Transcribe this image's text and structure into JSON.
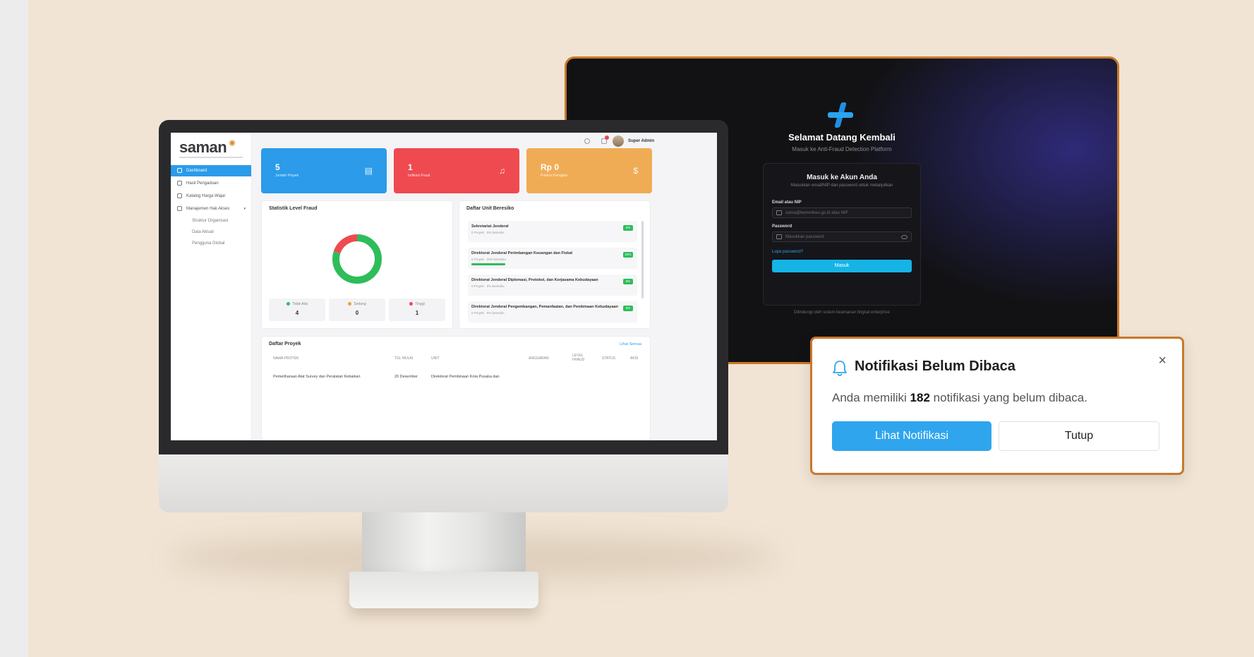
{
  "login": {
    "title": "Selamat Datang Kembali",
    "subtitle": "Masuk ke Anti-Fraud Detection Platform",
    "card_title": "Masuk ke Akun Anda",
    "card_subtitle": "Masukkan email/NIP dan password untuk melanjutkan",
    "email_label": "Email atau NIP",
    "email_placeholder": "nama@kemenkeu.go.id atau NIP",
    "password_label": "Password",
    "password_placeholder": "Masukkan password",
    "forgot": "Lupa password?",
    "submit": "Masuk",
    "footer": "Dilindungi oleh sistem keamanan tingkat enterprise"
  },
  "dashboard": {
    "brand": "saman",
    "nav": [
      "Dashboard",
      "Hasil Pengaduan",
      "Katalog Harga Wajar",
      "Manajemen Hak Akses"
    ],
    "subnav": [
      "Struktur Organisasi",
      "Data Aktual",
      "Pengguna Global"
    ],
    "user": "Super Admin",
    "stats": [
      {
        "value": "5",
        "label": "Jumlah Proyek",
        "color": "#2b9bea",
        "icon": "document-icon"
      },
      {
        "value": "1",
        "label": "Indikasi Fraud",
        "color": "#ef4a50",
        "icon": "bell-icon"
      },
      {
        "value": "Rp 0",
        "label": "Potensi Kerugian",
        "color": "#f0ac55",
        "icon": "dollar-icon"
      }
    ],
    "fraud_panel": {
      "title": "Statistik Level Fraud",
      "legend": [
        {
          "name": "Tidak Ada",
          "value": "4",
          "color": "#2ebd5a"
        },
        {
          "name": "Sedang",
          "value": "0",
          "color": "#f0a03a"
        },
        {
          "name": "Tinggi",
          "value": "1",
          "color": "#ef4a50"
        }
      ],
      "donut_fractions": [
        0.8,
        0.0,
        0.2
      ]
    },
    "units_panel": {
      "title": "Daftar Unit Beresiko",
      "items": [
        {
          "name": "Sekretariat Jenderal",
          "meta": "0 Proyek · 0% beresiko",
          "badge": "0%"
        },
        {
          "name": "Direktorat Jenderal Perimbangan Keuangan dan Fiskal",
          "meta": "5 Proyek · 20% beresiko",
          "badge": "20%"
        },
        {
          "name": "Direktorat Jenderal Diplomasi, Protokol, dan Kerjasama Kebudayaan",
          "meta": "0 Proyek · 0% beresiko",
          "badge": "0%"
        },
        {
          "name": "Direktorat Jenderal Pengembangan, Pemanfaatan, dan Pembinaan Kebudayaan",
          "meta": "0 Proyek · 0% beresiko",
          "badge": "0%"
        }
      ]
    },
    "projects": {
      "title": "Daftar Proyek",
      "see_all": "Lihat Semua",
      "columns": [
        "NAMA PROYEK",
        "TGL MULAI",
        "UNIT",
        "ANGGARAN",
        "LEVEL FRAUD",
        "STATUS",
        "AKSI"
      ],
      "first_row": {
        "name": "Pemeliharaan Alat Survey dan Peralatan Kebaikan",
        "date": "20 Desember",
        "unit": "Direktorat Pembinaan Kota Pusaka dan"
      }
    }
  },
  "notification": {
    "title": "Notifikasi Belum Dibaca",
    "message_pre": "Anda memiliki",
    "count": "182",
    "message_post": "notifikasi yang belum dibaca.",
    "primary": "Lihat Notifikasi",
    "secondary": "Tutup",
    "close": "×"
  },
  "colors": {
    "background": "#f1e4d4",
    "accent_border": "#c9782a",
    "primary": "#2fa5ee"
  }
}
